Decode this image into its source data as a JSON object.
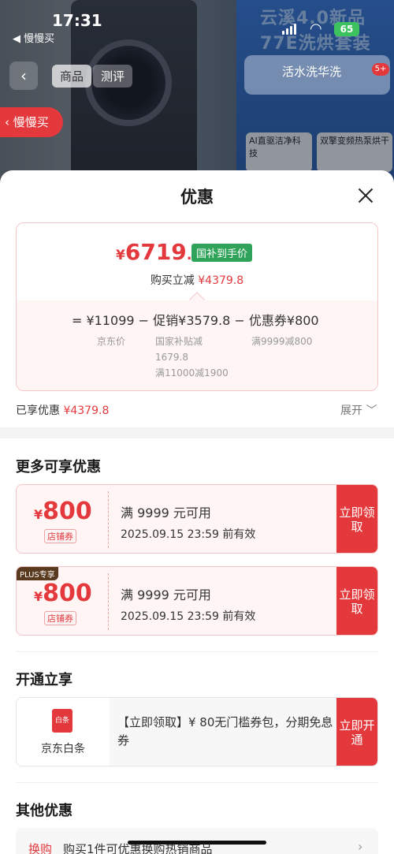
{
  "status": {
    "time": "17:31",
    "back_app": "◀ 慢慢买",
    "battery": "65"
  },
  "background": {
    "banner_text": [
      "云溪4.0新品",
      "77E洗烘套装"
    ],
    "tabs": [
      "商品",
      "测评"
    ],
    "nav_right": "活水洗华洗",
    "badge": "5+",
    "features": [
      "AI直驱洁净科技",
      "双擎变频热泵烘干"
    ],
    "slow_buy": "慢慢买"
  },
  "sheet": {
    "title": "优惠",
    "price": {
      "currency": "¥",
      "integer": "6719",
      "decimal": ".2",
      "tag": "国补到手价"
    },
    "reduce_label": "购买立减",
    "reduce_value": "¥4379.8",
    "formula": {
      "text": "= ¥11099 − 促销¥3579.8 − 优惠券¥800",
      "jd_price_label": "京东价",
      "promo_lines": [
        "国家补贴减",
        "1679.8",
        "满11000减1900"
      ],
      "coupon_line": "满9999减800"
    },
    "enjoyed_label": "已享优惠",
    "enjoyed_value": "¥4379.8",
    "expand": "展开 ﹀",
    "more_title": "更多可享优惠",
    "coupons": [
      {
        "currency": "¥",
        "amount": "800",
        "type": "店铺券",
        "condition": "满 9999 元可用",
        "valid": "2025.09.15 23:59 前有效",
        "action": "立即领取",
        "plus": ""
      },
      {
        "currency": "¥",
        "amount": "800",
        "type": "店铺券",
        "condition": "满 9999 元可用",
        "valid": "2025.09.15 23:59 前有效",
        "action": "立即领取",
        "plus": "PLUS专享"
      }
    ],
    "open_title": "开通立享",
    "baitiao": {
      "icon_text": "白条",
      "name": "京东白条",
      "text": "【立即领取】¥ 80无门槛券包，分期免息券",
      "action": "立即开通"
    },
    "other_title": "其他优惠",
    "other": {
      "tag": "换购",
      "text": "购买1件可优惠换购热销商品",
      "arrow": "›"
    }
  }
}
